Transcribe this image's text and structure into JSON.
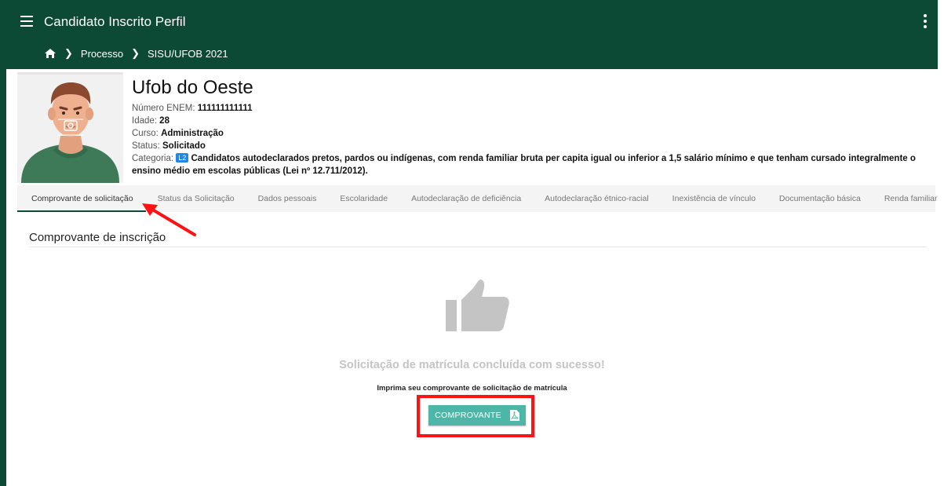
{
  "appbar": {
    "title": "Candidato Inscrito Perfil",
    "menu_icon": "hamburger-menu-icon",
    "more_icon": "more-vert-icon",
    "color": "#0c4a35"
  },
  "breadcrumb": {
    "home_icon": "home-icon",
    "items": [
      "Processo",
      "SISU/UFOB 2021"
    ]
  },
  "profile": {
    "name": "Ufob do Oeste",
    "enem_label": "Número ENEM: ",
    "enem_value": "111111111111",
    "age_label": "Idade: ",
    "age_value": "28",
    "course_label": "Curso: ",
    "course_value": "Administração",
    "status_label": "Status: ",
    "status_value": "Solicitado",
    "category_label": "Categoria: ",
    "category_badge": "L2",
    "category_value": "Candidatos autodeclarados pretos, pardos ou indígenas, com renda familiar bruta per capita igual ou inferior a 1,5 salário mínimo e que tenham cursado integralmente o ensino médio em escolas públicas (Lei nº 12.711/2012)."
  },
  "tabs": [
    {
      "label": "Comprovante de solicitação",
      "active": true
    },
    {
      "label": "Status da Solicitação"
    },
    {
      "label": "Dados pessoais"
    },
    {
      "label": "Escolaridade"
    },
    {
      "label": "Autodeclaração de deficiência"
    },
    {
      "label": "Autodeclaração étnico-racial"
    },
    {
      "label": "Inexistência de vínculo"
    },
    {
      "label": "Documentação básica"
    },
    {
      "label": "Renda familiar"
    }
  ],
  "main": {
    "section_title": "Comprovante de inscrição",
    "success_icon": "thumbs-up-icon",
    "success_message": "Solicitação de matrícula concluída com sucesso!",
    "print_hint": "Imprima seu comprovante de solicitação de matrícula",
    "button_label": "COMPROVANTE",
    "button_icon": "pdf-file-icon",
    "button_color": "#4db6a6",
    "highlight_color": "#ff1212"
  }
}
